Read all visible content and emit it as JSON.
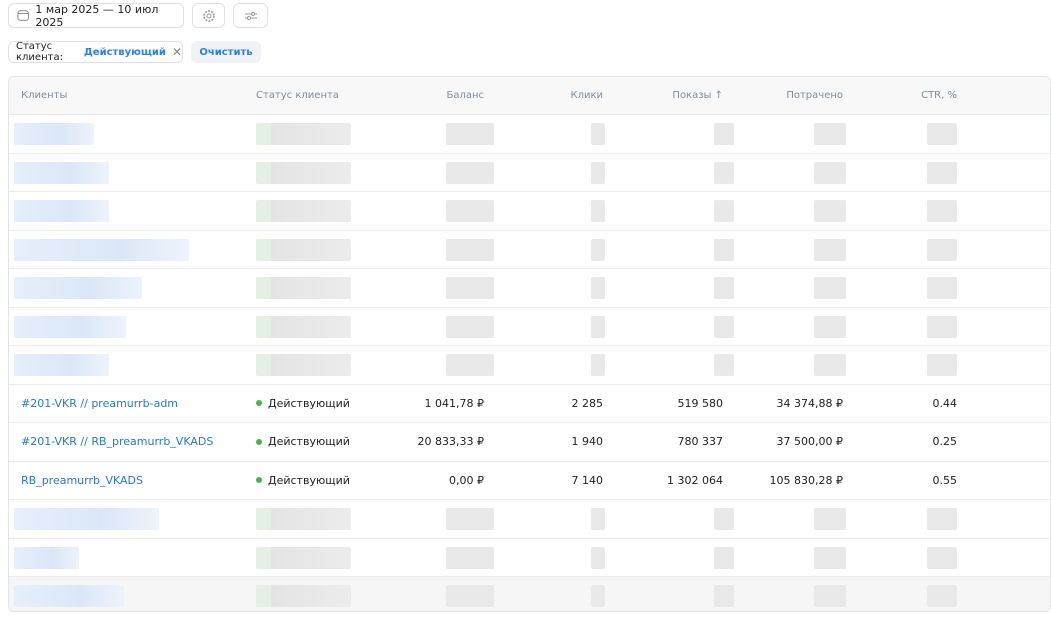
{
  "toolbar": {
    "date_range": "1 мар 2025 — 10 июл 2025",
    "calendar_icon": "calendar-icon",
    "settings_icon": "gear-icon",
    "filters_icon": "sliders-icon"
  },
  "filter": {
    "label": "Статус клиента:",
    "value": "Действующий",
    "clear_label": "Очистить"
  },
  "table": {
    "columns": [
      "Клиенты",
      "Статус клиента",
      "Баланс",
      "Клики",
      "Показы ↑",
      "Потрачено",
      "CTR, %"
    ],
    "rows": [
      {
        "client": "#201-VKR // preamurrb-adm",
        "status": "Действующий",
        "balance": "1 041,78 ₽",
        "clicks": "2 285",
        "shows": "519 580",
        "spent": "34 374,88 ₽",
        "ctr": "0.44"
      },
      {
        "client": "#201-VKR // RB_preamurrb_VKADS",
        "status": "Действующий",
        "balance": "20 833,33 ₽",
        "clicks": "1 940",
        "shows": "780 337",
        "spent": "37 500,00 ₽",
        "ctr": "0.25"
      },
      {
        "client": "RB_preamurrb_VKADS",
        "status": "Действующий",
        "balance": "0,00 ₽",
        "clicks": "7 140",
        "shows": "1 302 064",
        "spent": "105 830,28 ₽",
        "ctr": "0.55"
      }
    ]
  },
  "colors": {
    "accent": "#2d81e0",
    "link": "#2a7ac4",
    "status_active": "#4bb34b"
  }
}
